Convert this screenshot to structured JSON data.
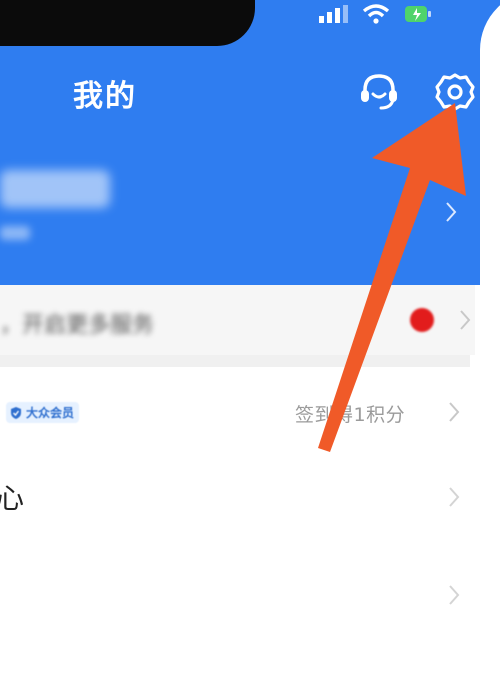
{
  "header": {
    "title": "我的",
    "background_color": "#2f7df0",
    "icons": [
      "customer-service-icon",
      "settings-gear-icon"
    ]
  },
  "status_bar": {
    "icons": [
      "signal-icon",
      "wifi-icon",
      "battery-icon"
    ]
  },
  "rows": [
    {
      "id": "more-services",
      "label": "",
      "trailing_icons": [
        "red-dot-icon",
        "chevron-right-icon"
      ]
    },
    {
      "id": "points",
      "badge": "大众会员",
      "trailing_text": "签到得1积分",
      "trailing_icon": "chevron-right-icon"
    },
    {
      "id": "center",
      "label": "心",
      "trailing_icon": "chevron-right-icon"
    },
    {
      "id": "blank",
      "label": "",
      "trailing_icon": "chevron-right-icon"
    }
  ],
  "annotation": {
    "type": "arrow",
    "color": "#f05a28",
    "target": "settings-gear-icon"
  }
}
